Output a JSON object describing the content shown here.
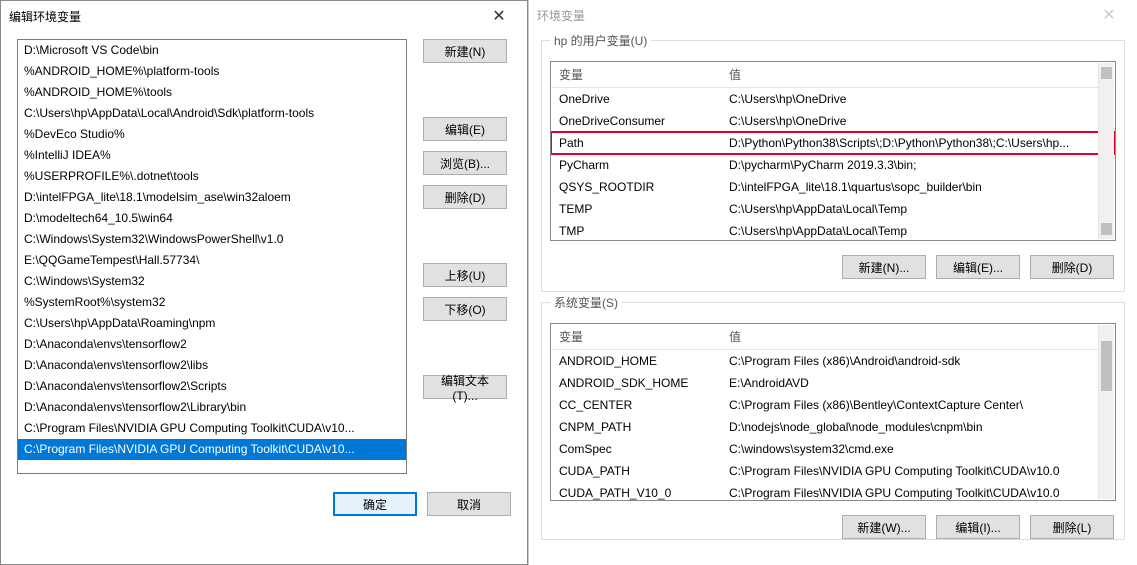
{
  "left_dialog": {
    "title": "编辑环境变量",
    "close": "✕",
    "paths": [
      "D:\\Microsoft VS Code\\bin",
      "%ANDROID_HOME%\\platform-tools",
      "%ANDROID_HOME%\\tools",
      "C:\\Users\\hp\\AppData\\Local\\Android\\Sdk\\platform-tools",
      "%DevEco Studio%",
      "%IntelliJ IDEA%",
      "%USERPROFILE%\\.dotnet\\tools",
      "D:\\intelFPGA_lite\\18.1\\modelsim_ase\\win32aloem",
      "D:\\modeltech64_10.5\\win64",
      "C:\\Windows\\System32\\WindowsPowerShell\\v1.0",
      "E:\\QQGameTempest\\Hall.57734\\",
      "C:\\Windows\\System32",
      "%SystemRoot%\\system32",
      "C:\\Users\\hp\\AppData\\Roaming\\npm",
      "D:\\Anaconda\\envs\\tensorflow2",
      "D:\\Anaconda\\envs\\tensorflow2\\libs",
      "D:\\Anaconda\\envs\\tensorflow2\\Scripts",
      "D:\\Anaconda\\envs\\tensorflow2\\Library\\bin",
      "C:\\Program Files\\NVIDIA GPU Computing Toolkit\\CUDA\\v10...",
      "C:\\Program Files\\NVIDIA GPU Computing Toolkit\\CUDA\\v10..."
    ],
    "selected_index": 19,
    "buttons": {
      "new": "新建(N)",
      "edit": "编辑(E)",
      "browse": "浏览(B)...",
      "delete": "删除(D)",
      "up": "上移(U)",
      "down": "下移(O)",
      "edit_text": "编辑文本(T)...",
      "ok": "确定",
      "cancel": "取消"
    }
  },
  "right_dialog": {
    "title": "环境变量",
    "close": "✕",
    "user_group_label": "hp 的用户变量(U)",
    "system_group_label": "系统变量(S)",
    "columns": {
      "name": "变量",
      "value": "值"
    },
    "user_vars": [
      {
        "name": "OneDrive",
        "value": "C:\\Users\\hp\\OneDrive"
      },
      {
        "name": "OneDriveConsumer",
        "value": "C:\\Users\\hp\\OneDrive"
      },
      {
        "name": "Path",
        "value": "D:\\Python\\Python38\\Scripts\\;D:\\Python\\Python38\\;C:\\Users\\hp..."
      },
      {
        "name": "PyCharm",
        "value": "D:\\pycharm\\PyCharm 2019.3.3\\bin;"
      },
      {
        "name": "QSYS_ROOTDIR",
        "value": "D:\\intelFPGA_lite\\18.1\\quartus\\sopc_builder\\bin"
      },
      {
        "name": "TEMP",
        "value": "C:\\Users\\hp\\AppData\\Local\\Temp"
      },
      {
        "name": "TMP",
        "value": "C:\\Users\\hp\\AppData\\Local\\Temp"
      }
    ],
    "user_highlight_index": 2,
    "system_vars": [
      {
        "name": "ANDROID_HOME",
        "value": "C:\\Program Files (x86)\\Android\\android-sdk"
      },
      {
        "name": "ANDROID_SDK_HOME",
        "value": "E:\\AndroidAVD"
      },
      {
        "name": "CC_CENTER",
        "value": "C:\\Program Files (x86)\\Bentley\\ContextCapture Center\\"
      },
      {
        "name": "CNPM_PATH",
        "value": "D:\\nodejs\\node_global\\node_modules\\cnpm\\bin"
      },
      {
        "name": "ComSpec",
        "value": "C:\\windows\\system32\\cmd.exe"
      },
      {
        "name": "CUDA_PATH",
        "value": "C:\\Program Files\\NVIDIA GPU Computing Toolkit\\CUDA\\v10.0"
      },
      {
        "name": "CUDA_PATH_V10_0",
        "value": "C:\\Program Files\\NVIDIA GPU Computing Toolkit\\CUDA\\v10.0"
      }
    ],
    "buttons": {
      "new": "新建(N)...",
      "edit": "编辑(E)...",
      "delete": "删除(D)",
      "new2": "新建(W)...",
      "edit2": "编辑(I)...",
      "delete2": "删除(L)"
    }
  }
}
